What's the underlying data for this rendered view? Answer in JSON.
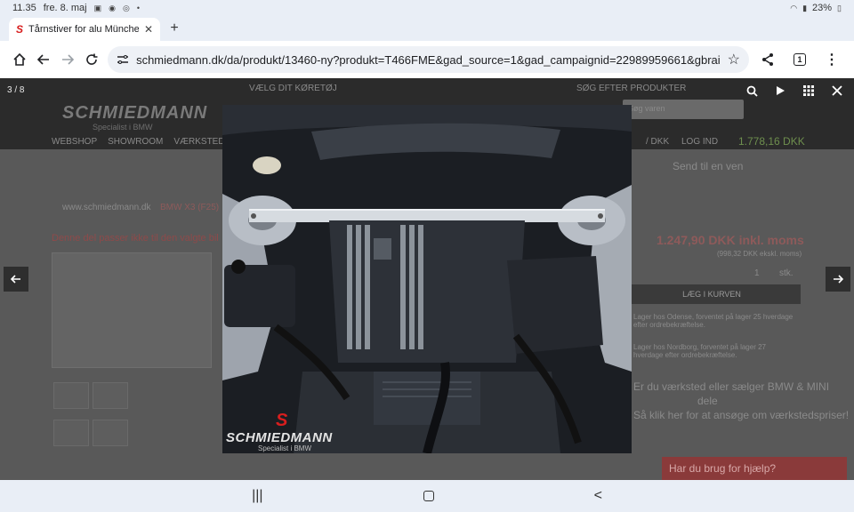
{
  "status": {
    "time": "11.35",
    "date": "fre. 8. maj",
    "battery": "23%"
  },
  "browser": {
    "tab_title": "Tårnstiver for alu Münche",
    "url": "schmiedmann.dk/da/produkt/13460-ny?produkt=T466FME&gad_source=1&gad_campaignid=22989959661&gbrai",
    "tab_count": "1"
  },
  "background_page": {
    "logo": "SCHMIEDMANN",
    "logo_sub": "Specialist i BMW",
    "choose_car": "VÆLG DIT KØRETØJ",
    "search_products": "SØG EFTER PRODUKTER",
    "search_placeholder": "Søg varen",
    "nav": [
      "WEBSHOP",
      "SHOWROOM",
      "VÆRKSTED"
    ],
    "login": "LOG IND",
    "currency": "/ DKK",
    "cart_total": "1.778,16 DKK",
    "breadcrumb_site": "www.schmiedmann.dk",
    "breadcrumb_model": "BMW X3 (F25)",
    "warning": "Denne del passer ikke til den valgte bil",
    "send_to_friend": "Send til en ven",
    "price": "1.247,90 DKK inkl. moms",
    "price_ex": "(998,32 DKK ekskl. moms)",
    "qty": "1",
    "unit": "stk.",
    "add_to_cart": "LÆG I KURVEN",
    "stock_odense": "Lager hos Odense, forventet på lager 25 hverdage efter ordrebekræftelse.",
    "stock_nordborg": "Lager hos Nordborg, forventet på lager 27 hverdage efter ordrebekræftelse.",
    "workshop_line1": "Er du værksted eller sælger BMW & MINI",
    "workshop_line2": "dele",
    "workshop_line3": "Så klik her for at ansøge om værkstedspriser!",
    "help_chat": "Har du brug for hjælp?"
  },
  "lightbox": {
    "counter": "3 / 8",
    "photo_logo": "SCHMIEDMANN",
    "photo_logo_sub": "Specialist i BMW",
    "photo_brand_mark": "S"
  },
  "icons": {
    "back": "arrow-left-icon",
    "forward": "arrow-right-icon",
    "reload": "reload-icon",
    "home": "home-icon",
    "bookmark": "star-icon",
    "share": "share-icon",
    "menu": "kebab-menu-icon",
    "zoom": "magnifier-icon",
    "slideshow": "play-icon",
    "grid": "grid-icon",
    "close": "close-icon"
  },
  "colors": {
    "brand_red": "#d81e1e",
    "overlay": "#5c5c5c",
    "chrome_bg": "#e9eef6"
  }
}
